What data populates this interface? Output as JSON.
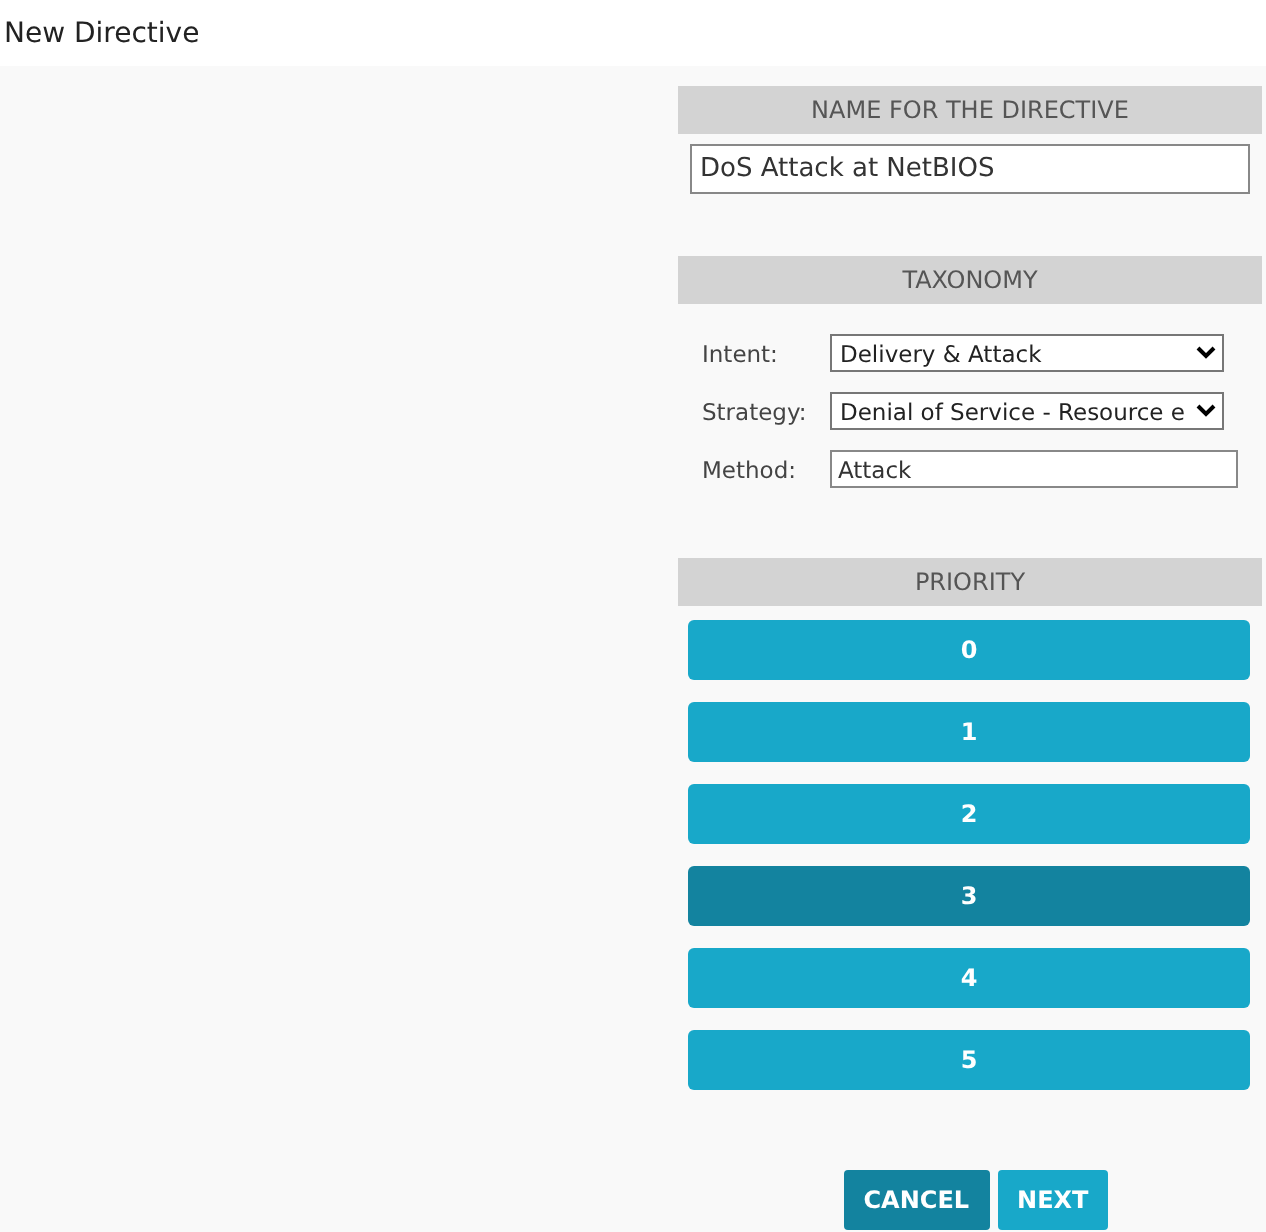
{
  "window": {
    "title": "New Directive"
  },
  "name_section": {
    "heading": "NAME FOR THE DIRECTIVE",
    "value": "DoS Attack at NetBIOS"
  },
  "taxonomy": {
    "heading": "TAXONOMY",
    "fields": [
      {
        "kind": "select",
        "label": "Intent:",
        "value": "Delivery & Attack"
      },
      {
        "kind": "select",
        "label": "Strategy:",
        "value": "Denial of Service - Resource e"
      },
      {
        "kind": "text",
        "label": "Method:",
        "value": "Attack"
      }
    ]
  },
  "priority": {
    "heading": "PRIORITY",
    "options": [
      {
        "label": "0",
        "selected": false
      },
      {
        "label": "1",
        "selected": false
      },
      {
        "label": "2",
        "selected": false
      },
      {
        "label": "3",
        "selected": true
      },
      {
        "label": "4",
        "selected": false
      },
      {
        "label": "5",
        "selected": false
      }
    ]
  },
  "buttons": [
    {
      "label": "CANCEL",
      "kind": "secondary"
    },
    {
      "label": "NEXT",
      "kind": "primary"
    }
  ]
}
